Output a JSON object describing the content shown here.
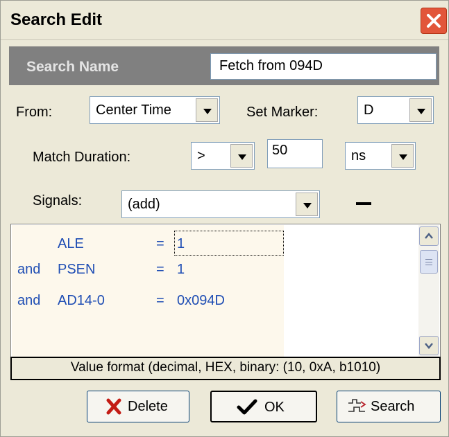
{
  "window": {
    "title": "Search Edit"
  },
  "search_name": {
    "label": "Search Name",
    "value": "Fetch from 094D"
  },
  "from": {
    "label": "From:",
    "value": "Center Time"
  },
  "set_marker": {
    "label": "Set Marker:",
    "value": "D"
  },
  "match_duration": {
    "label": "Match Duration:",
    "operator": ">",
    "value": "50",
    "unit": "ns"
  },
  "signals": {
    "label": "Signals:",
    "value": "(add)"
  },
  "conditions": [
    {
      "prefix": "",
      "signal": "ALE",
      "op": "=",
      "value": "1"
    },
    {
      "prefix": "and",
      "signal": "PSEN",
      "op": "=",
      "value": "1"
    },
    {
      "prefix": "and",
      "signal": "AD14-0",
      "op": "=",
      "value": "0x094D"
    }
  ],
  "status_hint": "Value format (decimal, HEX, binary:  (10, 0xA, b1010)",
  "buttons": {
    "delete": "Delete",
    "ok": "OK",
    "search": "Search"
  },
  "colors": {
    "condition_text": "#1f4eb4",
    "condition_bg": "#fdf8ec",
    "header_bar": "#808080",
    "close_button": "#e2563a"
  }
}
